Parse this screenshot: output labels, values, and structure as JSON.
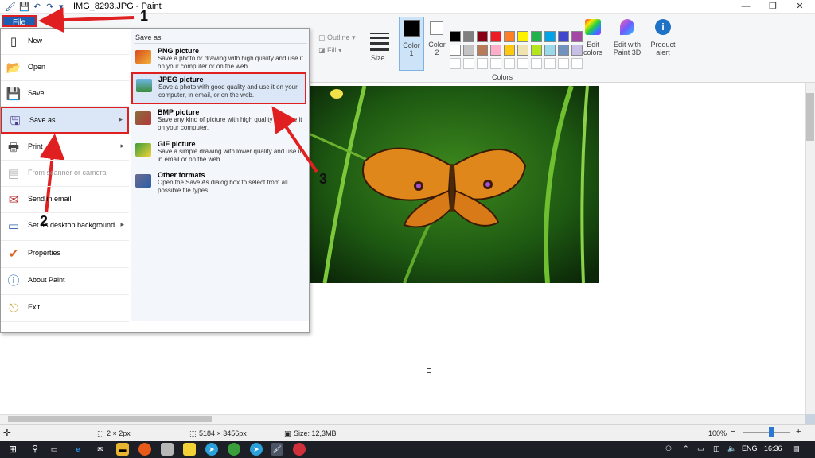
{
  "window": {
    "title": "IMG_8293.JPG - Paint",
    "minimize_glyph": "—",
    "maximize_glyph": "❐",
    "close_glyph": "✕"
  },
  "ribbon": {
    "file_tab": "File",
    "outline_label": "Outline",
    "fill_label": "Fill",
    "size_label": "Size",
    "color1_label": "Color\n1",
    "color1_a": "Color",
    "color1_b": "1",
    "color2_a": "Color",
    "color2_b": "2",
    "colors_group_label": "Colors",
    "edit_colors_a": "Edit",
    "edit_colors_b": "colors",
    "paint3d_a": "Edit with",
    "paint3d_b": "Paint 3D",
    "product_alert_a": "Product",
    "product_alert_b": "alert",
    "palette_row1": [
      "#000000",
      "#7f7f7f",
      "#880015",
      "#ed1c24",
      "#ff7f27",
      "#fff200",
      "#22b14c",
      "#00a2e8",
      "#3f48cc",
      "#a349a4"
    ],
    "palette_row2": [
      "#ffffff",
      "#c3c3c3",
      "#b97a57",
      "#ffaec9",
      "#ffc90e",
      "#efe4b0",
      "#b5e61d",
      "#99d9ea",
      "#7092be",
      "#c8bfe7"
    ]
  },
  "file_menu": {
    "items": [
      {
        "label": "New",
        "icon": "new-document-icon"
      },
      {
        "label": "Open",
        "icon": "open-folder-icon"
      },
      {
        "label": "Save",
        "icon": "save-disk-icon"
      },
      {
        "label": "Save as",
        "icon": "save-as-icon",
        "has_submenu": true
      },
      {
        "label": "Print",
        "icon": "printer-icon",
        "has_submenu": true
      },
      {
        "label": "From scanner or camera",
        "icon": "scanner-icon",
        "disabled": true
      },
      {
        "label": "Send in email",
        "icon": "email-icon"
      },
      {
        "label": "Set as desktop background",
        "icon": "desktop-background-icon",
        "has_submenu": true
      },
      {
        "label": "Properties",
        "icon": "checkmark-icon"
      },
      {
        "label": "About Paint",
        "icon": "info-icon"
      },
      {
        "label": "Exit",
        "icon": "exit-icon"
      }
    ],
    "submenu": {
      "title": "Save as",
      "items": [
        {
          "title": "PNG picture",
          "desc": "Save a photo or drawing with high quality and use it on your computer or on the web."
        },
        {
          "title": "JPEG picture",
          "desc": "Save a photo with good quality and use it on your computer, in email, or on the web."
        },
        {
          "title": "BMP picture",
          "desc": "Save any kind of picture with high quality and use it on your computer."
        },
        {
          "title": "GIF picture",
          "desc": "Save a simple drawing with lower quality and use it in email or on the web."
        },
        {
          "title": "Other formats",
          "desc": "Open the Save As dialog box to select from all possible file types."
        }
      ]
    }
  },
  "status": {
    "brush_size": "2 × 2px",
    "dimensions": "5184 × 3456px",
    "file_size": "Size: 12,3MB",
    "zoom": "100%",
    "zoom_minus": "−",
    "zoom_plus": "+"
  },
  "taskbar": {
    "language": "ENG",
    "time": "16:36"
  },
  "annotations": {
    "step1": "1",
    "step2": "2",
    "step3": "3",
    "highlight_color": "#e02020"
  }
}
